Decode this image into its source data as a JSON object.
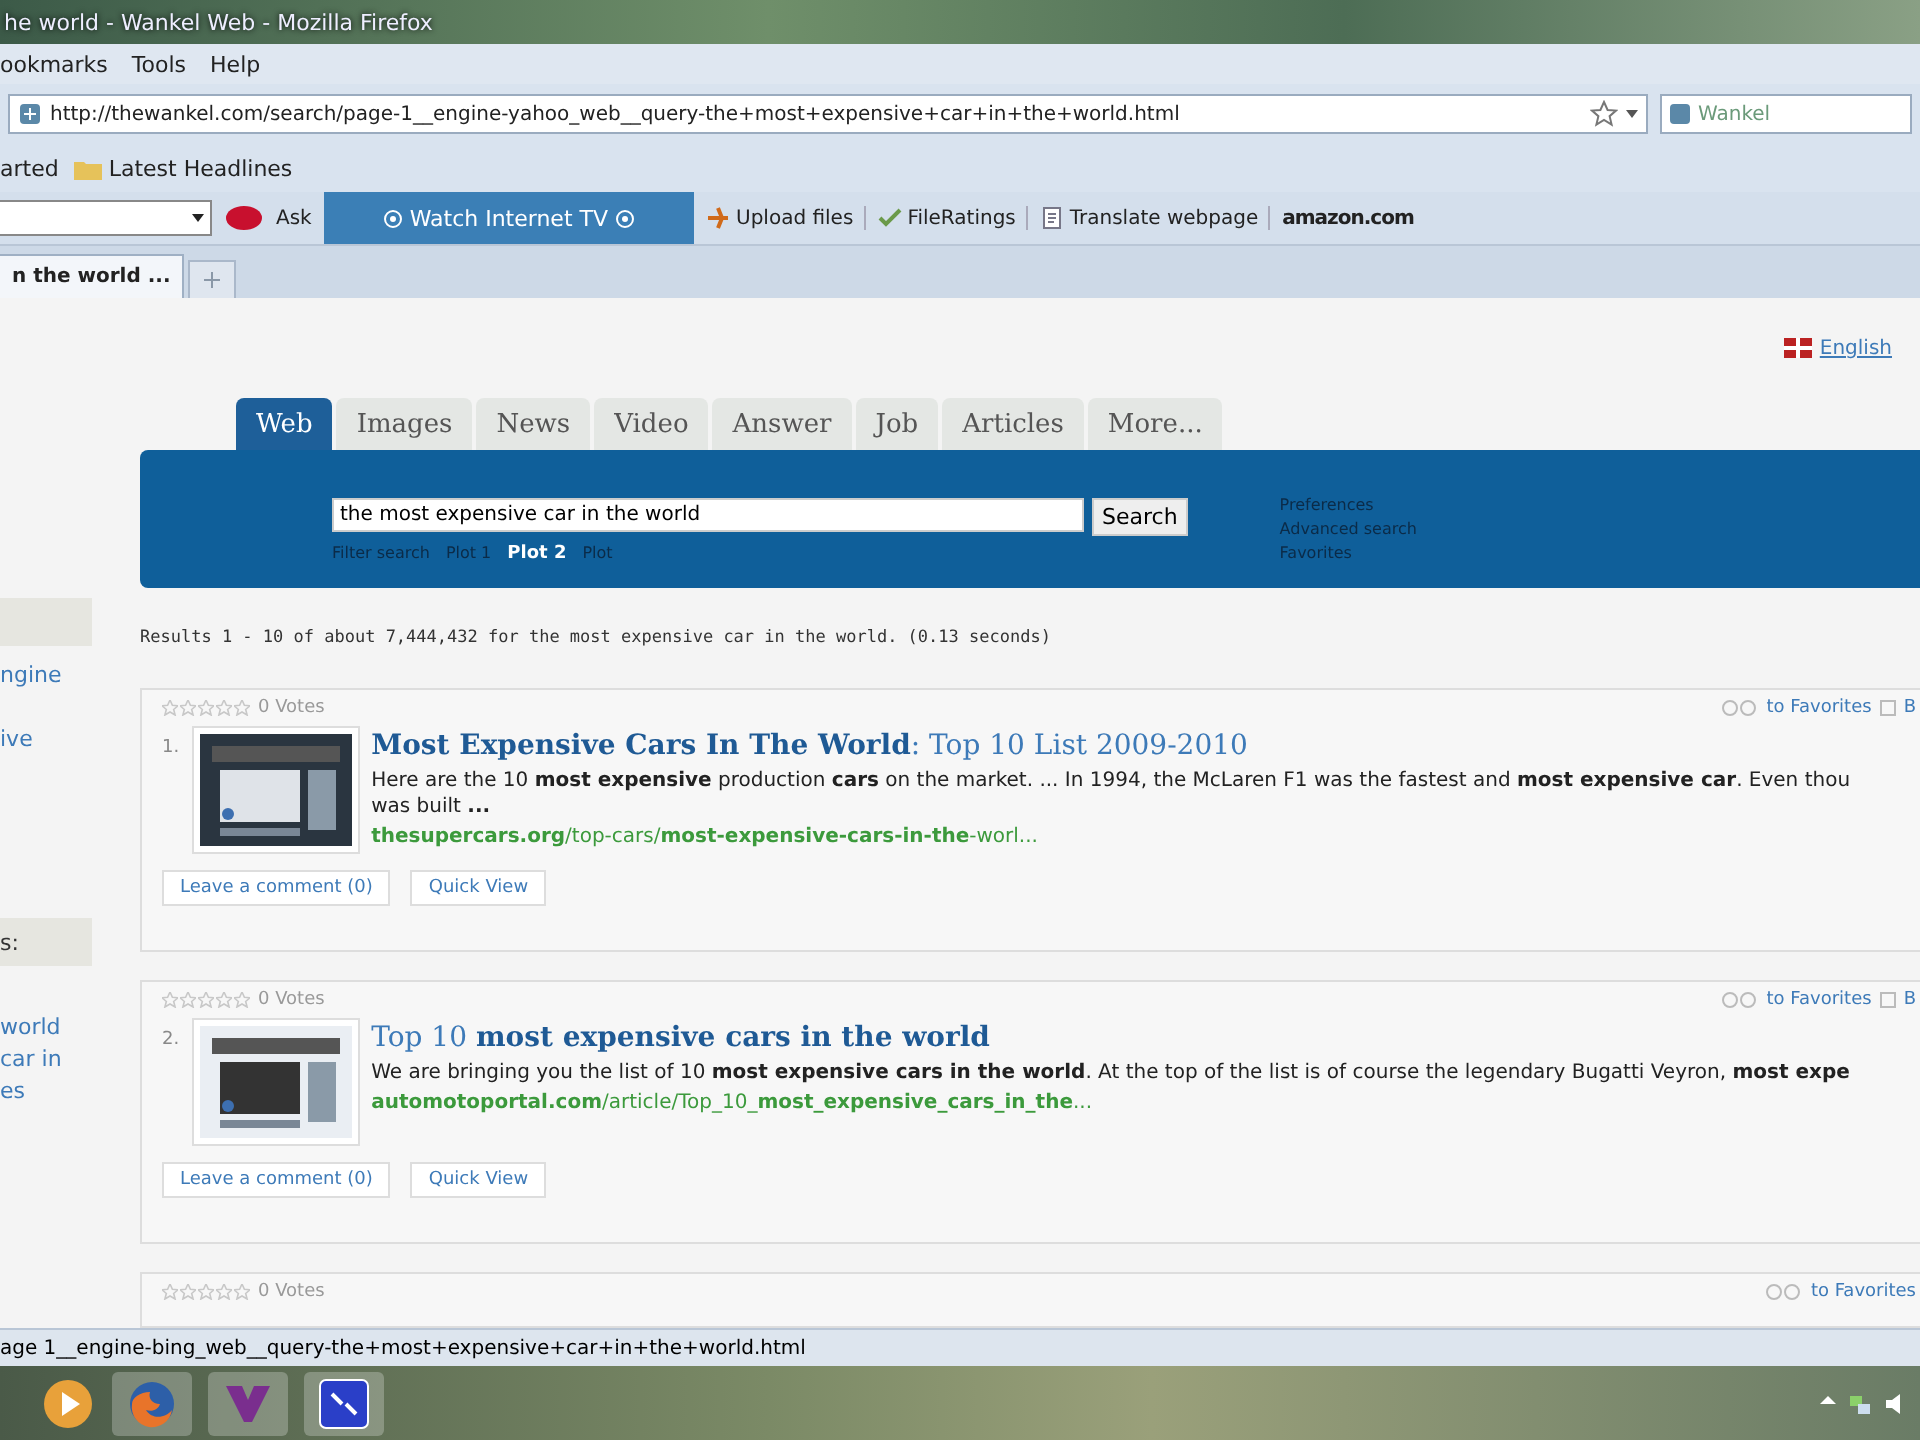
{
  "window": {
    "title": "he world - Wankel Web - Mozilla Firefox"
  },
  "menu": [
    "ookmarks",
    "Tools",
    "Help"
  ],
  "address_bar": {
    "url": "http://thewankel.com/search/page-1__engine-yahoo_web__query-the+most+expensive+car+in+the+world.html",
    "search_placeholder": "Wankel"
  },
  "bookmarks": [
    "arted",
    "Latest Headlines"
  ],
  "toolbar": {
    "ask": "Ask",
    "watch_tv": "Watch Internet TV",
    "items": [
      "Upload files",
      "FileRatings",
      "Translate webpage"
    ],
    "amazon": "amazon.com"
  },
  "browser_tab": {
    "label": "n the world ..."
  },
  "language": "English",
  "search_tabs": [
    {
      "label": "Web",
      "selected": true
    },
    {
      "label": "Images",
      "selected": false
    },
    {
      "label": "News",
      "selected": false
    },
    {
      "label": "Video",
      "selected": false
    },
    {
      "label": "Answer",
      "selected": false
    },
    {
      "label": "Job",
      "selected": false
    },
    {
      "label": "Articles",
      "selected": false
    },
    {
      "label": "More...",
      "selected": false
    }
  ],
  "search": {
    "value": "the most expensive car in the world",
    "button": "Search",
    "filters": [
      {
        "label": "Filter search",
        "selected": false
      },
      {
        "label": "Plot 1",
        "selected": false
      },
      {
        "label": "Plot 2",
        "selected": true
      },
      {
        "label": "Plot",
        "selected": false
      }
    ],
    "links": [
      "Preferences",
      "Advanced search",
      "Favorites"
    ]
  },
  "results_summary": "Results 1 - 10 of about 7,444,432 for the most expensive car in the world. (0.13 seconds)",
  "sidebar": [
    {
      "kind": "box"
    },
    {
      "kind": "link",
      "text": "ngine"
    },
    {
      "kind": "link",
      "text": "ive"
    },
    {
      "kind": "box",
      "text": "s:"
    },
    {
      "kind": "link",
      "text": "world"
    },
    {
      "kind": "link",
      "text": "car in"
    },
    {
      "kind": "link",
      "text": "es"
    }
  ],
  "results": [
    {
      "stars": 0,
      "votes": "0 Votes",
      "number": "1.",
      "title": "**Most Expensive Cars In The World**: Top 10 List 2009-2010",
      "snippet": "Here are the 10 **most expensive** production **cars** on the market. ... In 1994, the McLaren F1 was the fastest and **most expensive car**. Even thou was built **...**",
      "url": "**thesupercars.org**/top-cars/**most-expensive-cars-in-the**-worl...",
      "comment": "Leave a comment (0)",
      "quick_view": "Quick View",
      "favorites": "to Favorites",
      "extra": "B"
    },
    {
      "stars": 0,
      "votes": "0 Votes",
      "number": "2.",
      "title": "Top 10 **most expensive cars in the world**",
      "snippet": "We are bringing you the list of 10 **most expensive cars in the world**. At the top of the list is of course the legendary Bugatti Veyron, **most expe**",
      "url": "**automotoportal.com**/article/Top_10_**most_expensive_cars_in_the**...",
      "comment": "Leave a comment (0)",
      "quick_view": "Quick View",
      "favorites": "to Favorites",
      "extra": "B"
    },
    {
      "stars": 0,
      "votes": "0 Votes",
      "favorites": "to Favorites"
    }
  ],
  "status_bar": "age 1__engine-bing_web__query-the+most+expensive+car+in+the+world.html"
}
